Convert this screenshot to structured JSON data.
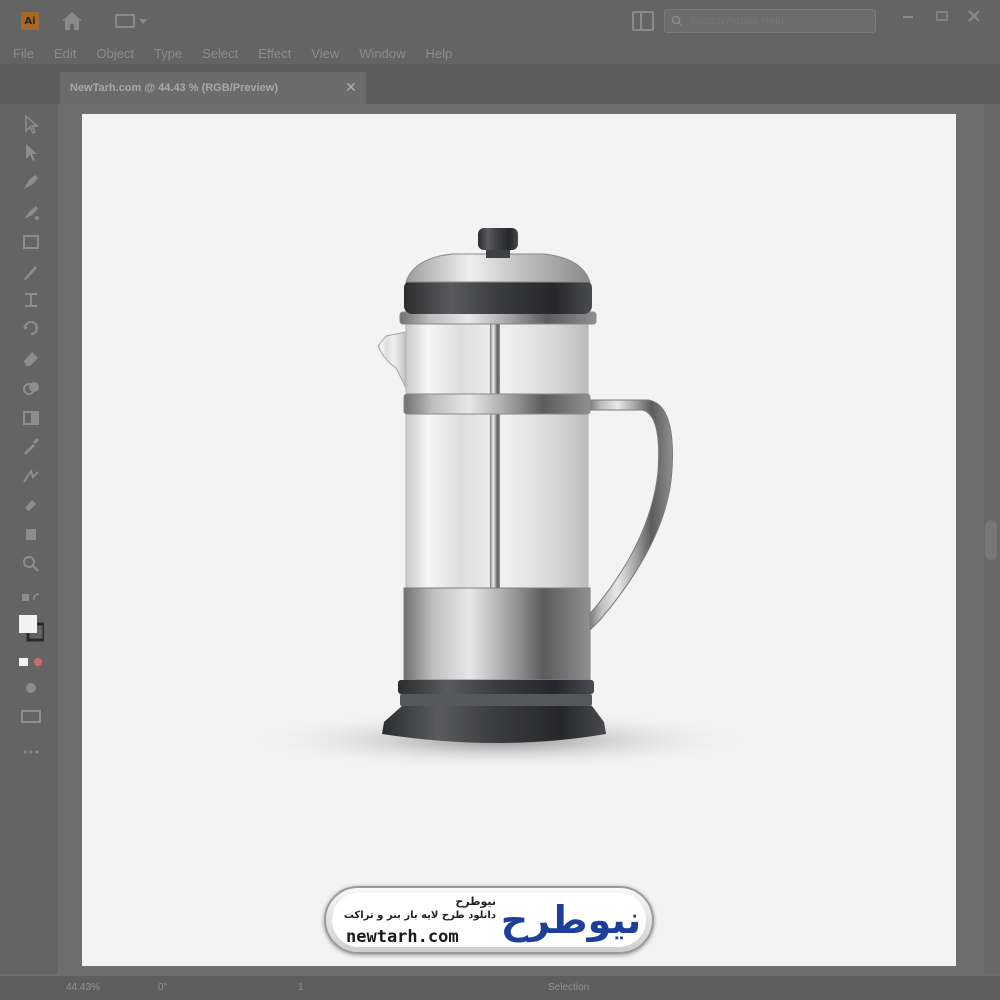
{
  "app": {
    "logo_text": "Ai",
    "menu": [
      "File",
      "Edit",
      "Object",
      "Type",
      "Select",
      "Effect",
      "View",
      "Window",
      "Help"
    ],
    "search_placeholder": "Search Adobe Help"
  },
  "document": {
    "tab_title": "NewTarh.com @ 44.43 % (RGB/Preview)",
    "close_symbol": "✕"
  },
  "status": {
    "zoom": "44.43%",
    "rotation": "0°",
    "artboard_number": "1",
    "mode": "Selection"
  },
  "watermark": {
    "brand_fa": "نیوطرح",
    "tagline_fa": "دانلود طرح لایه باز بنر و تراکت",
    "site": "newtarh.com",
    "logo_fa": "نیوطرح"
  },
  "colors": {
    "ui_bg": "#646464",
    "artboard": "#f3f3f3",
    "logo_blue": "#1d3f9a",
    "logo_red": "#e0282e",
    "plastic_dark": "#3e3f42"
  },
  "icons": [
    "home-icon",
    "workspace-icon",
    "arrange-docs-icon",
    "search-icon",
    "minimize-icon",
    "maximize-icon",
    "close-icon"
  ]
}
